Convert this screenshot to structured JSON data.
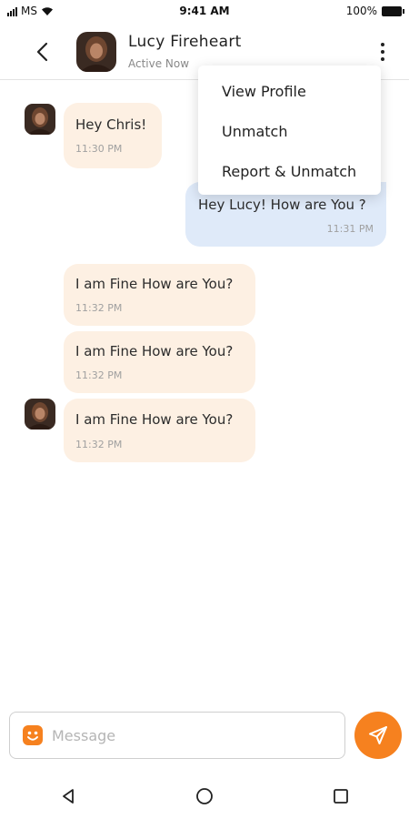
{
  "status_bar": {
    "carrier": "MS",
    "time": "9:41 AM",
    "battery": "100%"
  },
  "header": {
    "name": "Lucy Fireheart",
    "status": "Active Now"
  },
  "menu": {
    "items": [
      "View Profile",
      "Unmatch",
      "Report & Unmatch"
    ]
  },
  "messages": [
    {
      "direction": "in",
      "text": "Hey Chris!",
      "time": "11:30 PM",
      "avatar": true
    },
    {
      "direction": "out",
      "text": "Hey Lucy! How are You ?",
      "time": "11:31 PM",
      "avatar": false
    },
    {
      "direction": "in",
      "text": "I am Fine How are You?",
      "time": "11:32 PM",
      "avatar": false
    },
    {
      "direction": "in",
      "text": "I am Fine How are You?",
      "time": "11:32 PM",
      "avatar": false
    },
    {
      "direction": "in",
      "text": "I am Fine How are You?",
      "time": "11:32 PM",
      "avatar": true
    }
  ],
  "composer": {
    "placeholder": "Message",
    "value": ""
  },
  "colors": {
    "accent": "#f6811f",
    "incoming_bubble": "#fdf0e3",
    "outgoing_bubble": "#dfeaf9"
  },
  "icons": {
    "back": "chevron-left-icon",
    "more": "more-vertical-icon",
    "emoji": "smiley-icon",
    "send": "paper-plane-icon",
    "nav": [
      "back-triangle-icon",
      "home-circle-icon",
      "recents-square-icon"
    ]
  }
}
